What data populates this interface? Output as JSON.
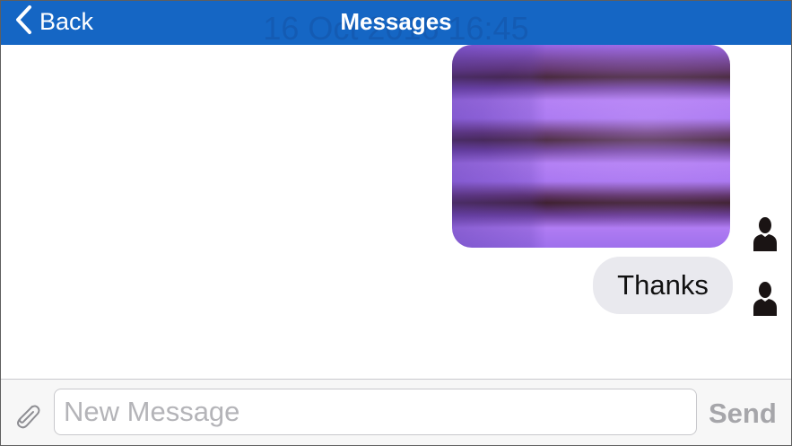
{
  "header": {
    "back_label": "Back",
    "title": "Messages",
    "timestamp": "16 Oct 2016 16:45"
  },
  "thread": {
    "messages": [
      {
        "type": "image",
        "sender": "me",
        "avatar_icon": "user-silhouette-icon"
      },
      {
        "type": "text",
        "text": "Thanks",
        "sender": "me",
        "avatar_icon": "user-silhouette-icon"
      }
    ]
  },
  "composer": {
    "attach_icon": "paperclip-icon",
    "input_placeholder": "New Message",
    "input_value": "",
    "send_label": "Send"
  },
  "colors": {
    "nav_bar": "#1566c4",
    "received_bubble": "#e9e9ee",
    "send_disabled": "#a6a6aa",
    "placeholder": "#b4b4b8"
  }
}
